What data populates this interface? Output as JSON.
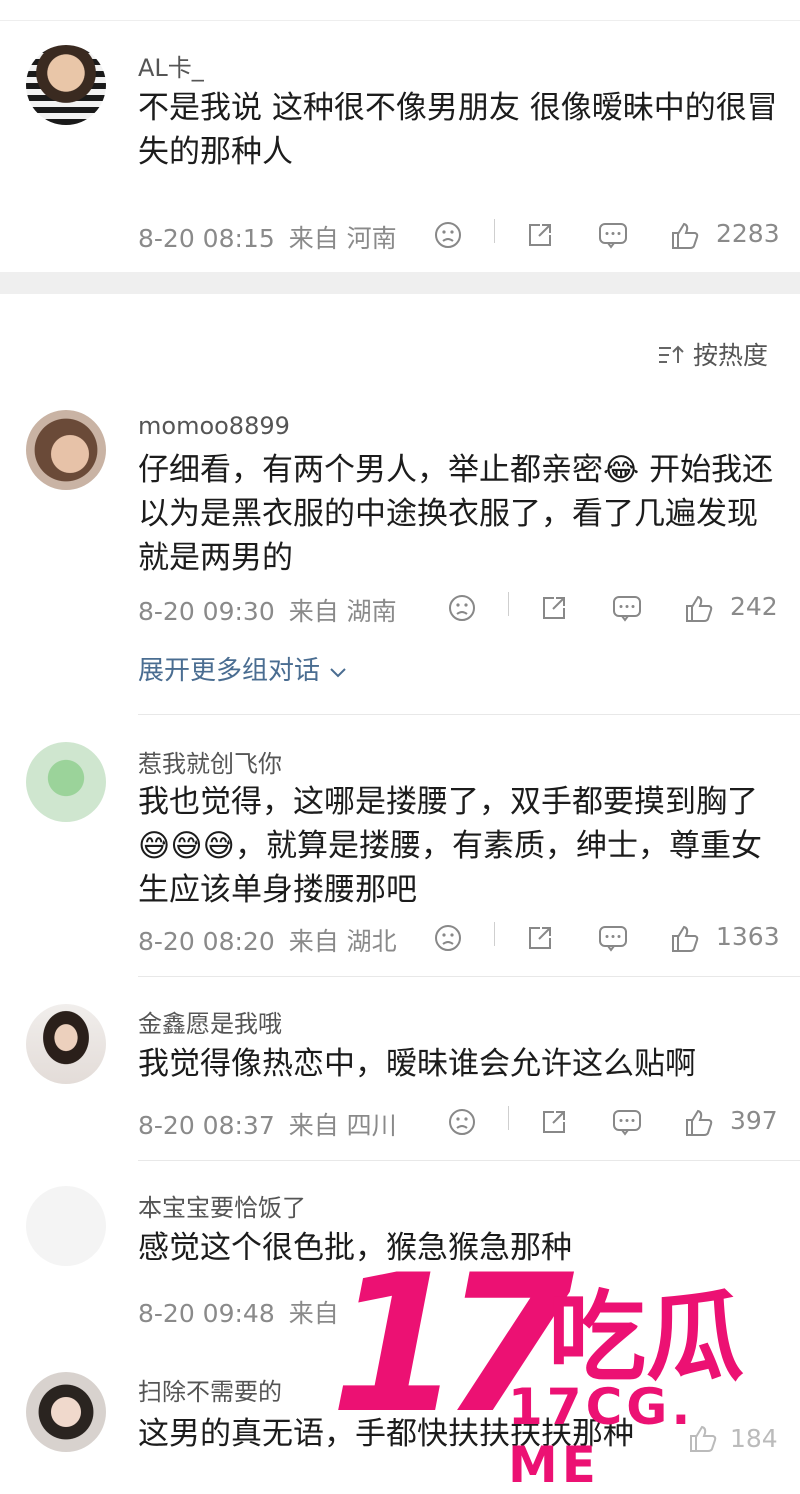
{
  "sort_label": "按热度",
  "expand_label": "展开更多组对话",
  "comments": [
    {
      "name": "AL卡_",
      "text": "不是我说 这种很不像男朋友 很像暧昧中的很冒失的那种人",
      "time": "8-20 08:15",
      "location": "来自 河南",
      "likes": "2283"
    },
    {
      "name": "momoo8899",
      "text": "仔细看，有两个男人，举止都亲密😂 开始我还以为是黑衣服的中途换衣服了，看了几遍发现就是两男的",
      "time": "8-20 09:30",
      "location": "来自 湖南",
      "likes": "242"
    },
    {
      "name": "惹我就创飞你",
      "text": "我也觉得，这哪是搂腰了，双手都要摸到胸了😅😅😅，就算是搂腰，有素质，绅士，尊重女生应该单身搂腰那吧",
      "time": "8-20 08:20",
      "location": "来自 湖北",
      "likes": "1363"
    },
    {
      "name": "金鑫愿是我哦",
      "text": "我觉得像热恋中，暧昧谁会允许这么贴啊",
      "time": "8-20 08:37",
      "location": "来自 四川",
      "likes": "397"
    },
    {
      "name": "本宝宝要恰饭了",
      "text": "感觉这个很色批，猴急猴急那种",
      "time": "8-20 09:48",
      "location": "来自",
      "likes": ""
    },
    {
      "name": "扫除不需要的",
      "text": "这男的真无语，手都快扶扶扶扶那种",
      "time": "",
      "location": "",
      "likes": "184"
    }
  ],
  "watermark": {
    "number": "17",
    "chinese": "吃瓜",
    "domain": "17CG. ME",
    "color": "#ec1173"
  },
  "icons": [
    "sad-face-icon",
    "share-icon",
    "comment-icon",
    "thumbs-up-icon",
    "sort-icon",
    "chevron-down-icon"
  ]
}
